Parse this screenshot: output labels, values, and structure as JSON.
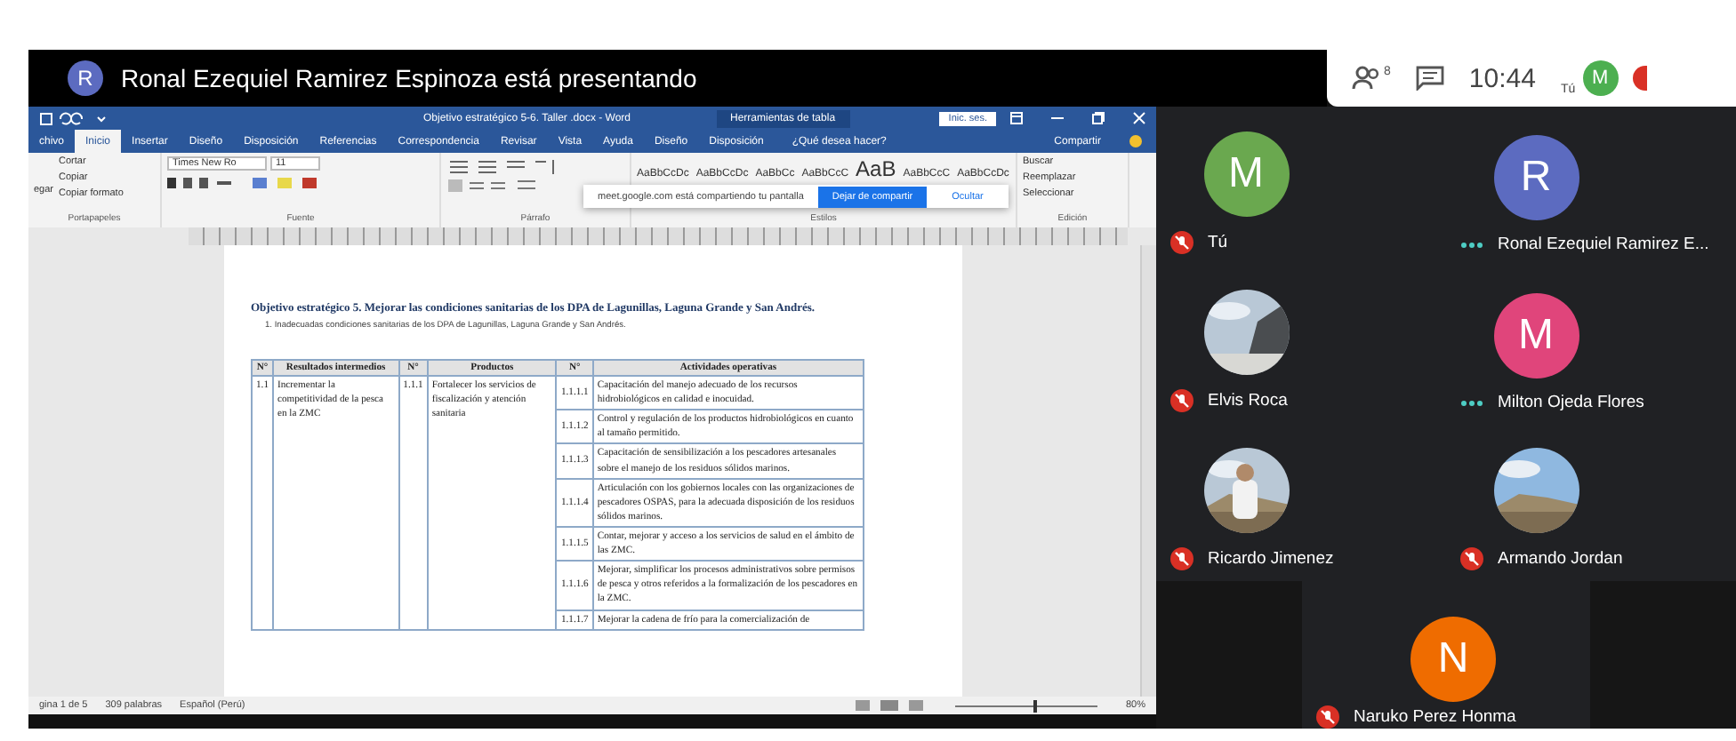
{
  "presenter_bar": {
    "initial": "R",
    "text": "Ronal Ezequiel Ramirez Espinoza está presentando"
  },
  "meet_panel": {
    "participant_count": "8",
    "time": "10:44",
    "self_label": "Tú",
    "self_initial": "M"
  },
  "word": {
    "title": "Objetivo estratégico 5-6. Taller .docx - Word",
    "table_tools": "Herramientas de tabla",
    "sign_in": "Inic. ses.",
    "tabs": [
      {
        "label": "chivo",
        "selected": false
      },
      {
        "label": "Inicio",
        "selected": true
      },
      {
        "label": "Insertar",
        "selected": false
      },
      {
        "label": "Diseño",
        "selected": false
      },
      {
        "label": "Disposición",
        "selected": false
      },
      {
        "label": "Referencias",
        "selected": false
      },
      {
        "label": "Correspondencia",
        "selected": false
      },
      {
        "label": "Revisar",
        "selected": false
      },
      {
        "label": "Vista",
        "selected": false
      },
      {
        "label": "Ayuda",
        "selected": false
      },
      {
        "label": "Diseño",
        "selected": false
      },
      {
        "label": "Disposición",
        "selected": false
      }
    ],
    "tell_me": "¿Qué desea hacer?",
    "share": "Compartir",
    "clipboard": {
      "paste": "egar",
      "items": [
        "Cortar",
        "Copiar",
        "Copiar formato"
      ],
      "group": "Portapapeles"
    },
    "font": {
      "name": "Times New Ro",
      "size": "11",
      "group": "Fuente"
    },
    "paragraph": {
      "group": "Párrafo"
    },
    "styles": {
      "samples": [
        "AaBbCcDc",
        "AaBbCcDc",
        "AaBbCc",
        "AaBbCcC",
        "AaB",
        "AaBbCcC",
        "AaBbCcDc"
      ],
      "group": "Estilos"
    },
    "editing": {
      "items": [
        "Buscar",
        "Reemplazar",
        "Seleccionar"
      ],
      "group": "Edición"
    },
    "share_notice": {
      "text": "meet.google.com está compartiendo tu pantalla",
      "stop": "Dejar de compartir",
      "hide": "Ocultar"
    },
    "document": {
      "heading": "Objetivo estratégico 5. Mejorar las condiciones sanitarias de los DPA de Lagunillas, Laguna Grande y San Andrés.",
      "subheading": "1.   Inadecuadas condiciones sanitarias de los DPA de Lagunillas, Laguna Grande y San Andrés.",
      "columns": [
        "N°",
        "Resultados intermedios",
        "N°",
        "Productos",
        "N°",
        "Actividades operativas"
      ],
      "result": {
        "number": "1.1",
        "text": "Incrementar la competitividad de la pesca en la ZMC"
      },
      "product": {
        "number": "1.1.1",
        "text": "Fortalecer los servicios de fiscalización y atención sanitaria"
      },
      "activities": [
        {
          "number": "1.1.1.1",
          "text": "Capacitación del manejo adecuado de los recursos hidrobiológicos en calidad e inocuidad."
        },
        {
          "number": "1.1.1.2",
          "text": "Control y regulación de los productos hidrobiológicos en cuanto al tamaño permitido."
        },
        {
          "number": "1.1.1.3",
          "text": "Capacitación de sensibilización a los pescadores artesanales sobre el manejo de los residuos sólidos marinos."
        },
        {
          "number": "1.1.1.4",
          "text": "Articulación con los gobiernos locales con las organizaciones de pescadores OSPAS, para la adecuada disposición de los residuos sólidos marinos."
        },
        {
          "number": "1.1.1.5",
          "text": "Contar, mejorar y acceso a los servicios de salud en el ámbito de las ZMC."
        },
        {
          "number": "1.1.1.6",
          "text": "Mejorar, simplificar los procesos administrativos sobre permisos de pesca y otros referidos a la formalización de los pescadores en la ZMC."
        },
        {
          "number": "1.1.1.7",
          "text": "Mejorar la cadena de frío para la comercialización de"
        }
      ]
    },
    "status": {
      "page": "gina 1 de 5",
      "words": "309 palabras",
      "language": "Español (Perú)",
      "zoom_slider": {
        "level": 0.55
      },
      "zoom": "80%"
    }
  },
  "participants": [
    {
      "name": "Tú",
      "kind": "letter",
      "initial": "M",
      "color": "#6aa84f",
      "muted": true
    },
    {
      "name": "Ronal Ezequiel Ramirez E...",
      "kind": "letter",
      "initial": "R",
      "color": "#5c6bc0",
      "muted": false
    },
    {
      "name": "Elvis Roca",
      "kind": "picture",
      "muted": true
    },
    {
      "name": "Milton Ojeda Flores",
      "kind": "letter",
      "initial": "M",
      "color": "#e0457b",
      "muted": false
    },
    {
      "name": "Ricardo Jimenez",
      "kind": "picture",
      "muted": true
    },
    {
      "name": "Armando Jordan",
      "kind": "picture",
      "muted": true
    },
    {
      "name": "Naruko Perez Honma",
      "kind": "letter",
      "initial": "N",
      "color": "#ef6c00",
      "muted": true
    }
  ]
}
